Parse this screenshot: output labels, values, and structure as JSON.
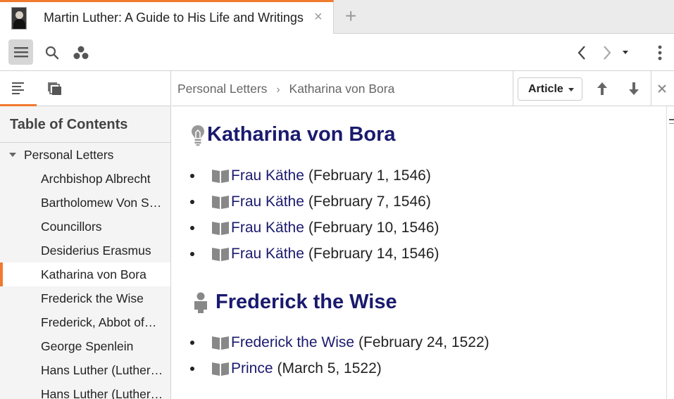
{
  "tab": {
    "title": "Martin Luther: A Guide to His Life and Writings",
    "close": "×",
    "add": "+"
  },
  "toolbar": {
    "icons": [
      "menu-icon",
      "search-icon",
      "cluster-icon",
      "back-icon",
      "forward-icon",
      "history-dropdown-icon",
      "more-icon"
    ]
  },
  "left_panel": {
    "heading": "Table of Contents",
    "items": [
      {
        "label": "Personal Letters",
        "parent": true
      },
      {
        "label": "Archbishop Albrecht"
      },
      {
        "label": "Bartholomew Von S…"
      },
      {
        "label": "Councillors"
      },
      {
        "label": "Desiderius Erasmus"
      },
      {
        "label": "Katharina von Bora",
        "active": true
      },
      {
        "label": "Frederick the Wise"
      },
      {
        "label": "Frederick, Abbot of…"
      },
      {
        "label": "George Spenlein"
      },
      {
        "label": "Hans Luther (Luther…"
      },
      {
        "label": "Hans Luther (Luther…"
      }
    ]
  },
  "content_head": {
    "breadcrumb": [
      "Personal Letters",
      "Katharina von Bora"
    ],
    "breadcrumb_sep": "›",
    "view_select": "Article"
  },
  "article": {
    "sections": [
      {
        "title": "Katharina von Bora",
        "icon": "lightbulb-icon",
        "entries": [
          {
            "link": "Frau Käthe",
            "date": "(February 1, 1546)"
          },
          {
            "link": "Frau Käthe",
            "date": "(February 7, 1546)"
          },
          {
            "link": "Frau Käthe",
            "date": "(February 10, 1546)"
          },
          {
            "link": "Frau Käthe",
            "date": "(February 14, 1546)"
          }
        ]
      },
      {
        "title": "Frederick the Wise",
        "icon": "person-icon",
        "entries": [
          {
            "link": "Frederick the Wise",
            "date": "(February 24, 1522)"
          },
          {
            "link": "Prince",
            "date": "(March 5, 1522)"
          }
        ]
      }
    ]
  },
  "colors": {
    "accent": "#f07a2e",
    "link": "#1a1a6e",
    "panel_bg": "#f4f4f4"
  }
}
